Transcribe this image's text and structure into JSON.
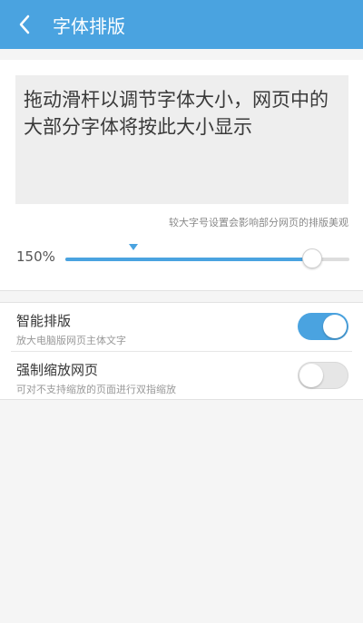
{
  "header": {
    "title": "字体排版",
    "back_icon": "chevron-left-icon"
  },
  "preview": {
    "text": "拖动滑杆以调节字体大小，网页中的大部分字体将按此大小显示"
  },
  "hint": "较大字号设置会影响部分网页的排版美观",
  "slider": {
    "value_label": "150%",
    "fill_fraction": 0.87,
    "default_marker_fraction": 0.24
  },
  "settings": [
    {
      "title": "智能排版",
      "subtitle": "放大电脑版网页主体文字",
      "enabled": true
    },
    {
      "title": "强制缩放网页",
      "subtitle": "可对不支持缩放的页面进行双指缩放",
      "enabled": false
    }
  ],
  "colors": {
    "accent": "#4aa3e0",
    "background": "#f5f5f5"
  }
}
